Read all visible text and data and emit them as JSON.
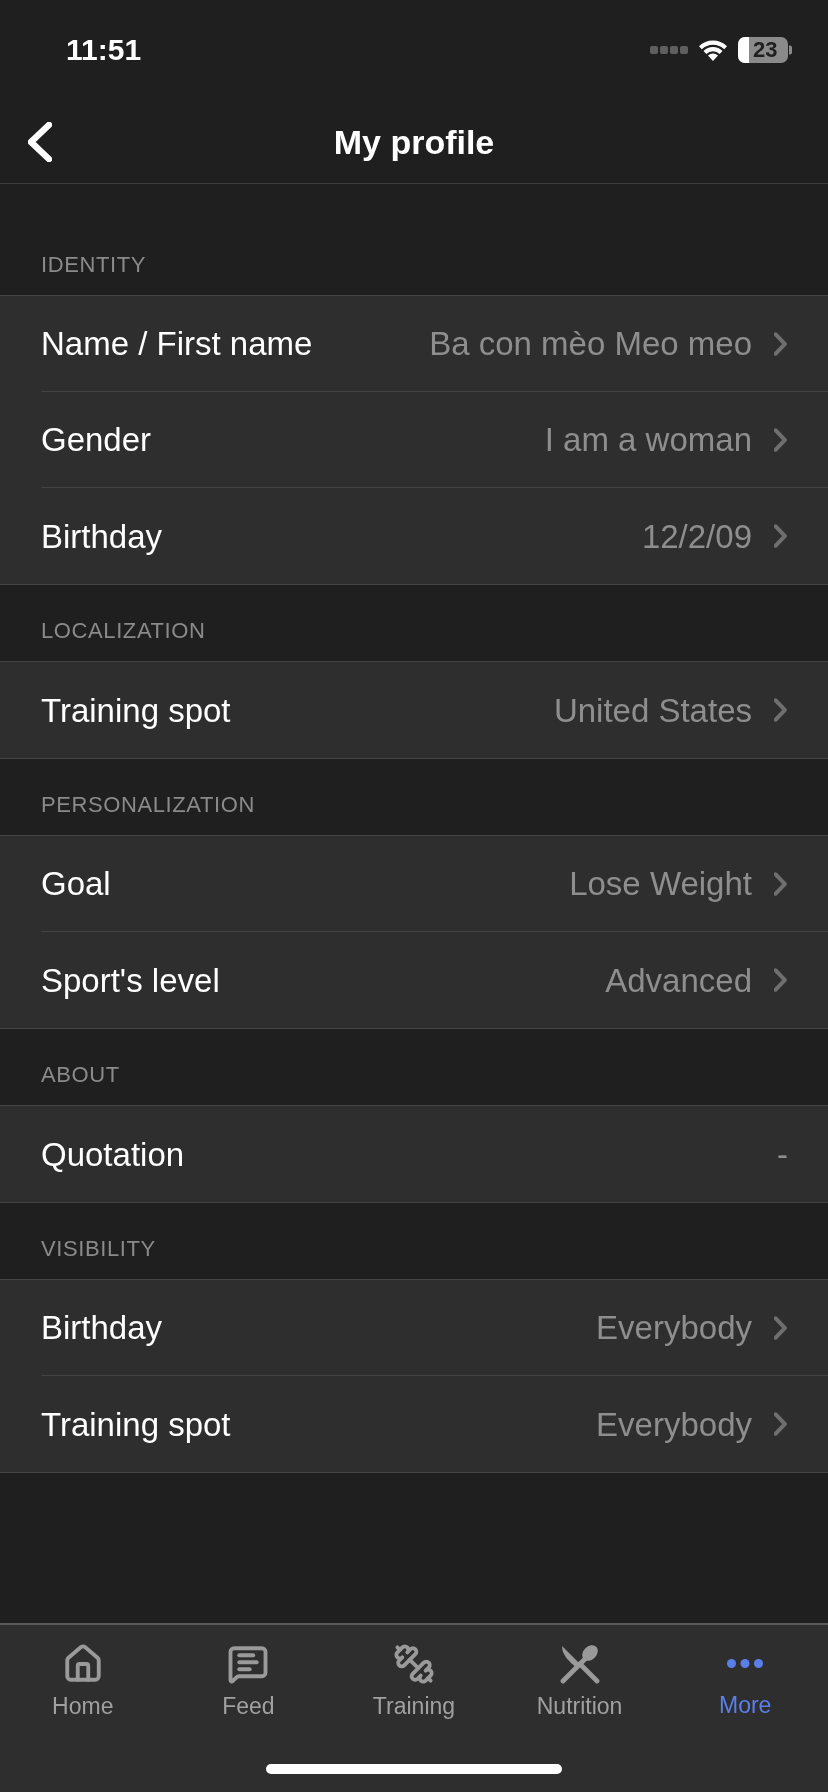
{
  "status_bar": {
    "time": "11:51",
    "battery": "23"
  },
  "nav": {
    "title": "My profile"
  },
  "sections": [
    {
      "header": "IDENTITY",
      "rows": [
        {
          "label": "Name / First name",
          "value": "Ba con mèo Meo meo",
          "chevron": true
        },
        {
          "label": "Gender",
          "value": "I am a woman",
          "chevron": true
        },
        {
          "label": "Birthday",
          "value": "12/2/09",
          "chevron": true
        }
      ]
    },
    {
      "header": "LOCALIZATION",
      "rows": [
        {
          "label": "Training spot",
          "value": "United States",
          "chevron": true
        }
      ]
    },
    {
      "header": "PERSONALIZATION",
      "rows": [
        {
          "label": "Goal",
          "value": "Lose Weight",
          "chevron": true
        },
        {
          "label": "Sport's level",
          "value": "Advanced",
          "chevron": true
        }
      ]
    },
    {
      "header": "ABOUT",
      "rows": [
        {
          "label": "Quotation",
          "value": "-",
          "chevron": false
        }
      ]
    },
    {
      "header": "VISIBILITY",
      "rows": [
        {
          "label": "Birthday",
          "value": "Everybody",
          "chevron": true
        },
        {
          "label": "Training spot",
          "value": "Everybody",
          "chevron": true
        }
      ]
    }
  ],
  "tab_bar": [
    {
      "kind": "home",
      "label": "Home",
      "selected": false
    },
    {
      "kind": "feed",
      "label": "Feed",
      "selected": false
    },
    {
      "kind": "training",
      "label": "Training",
      "selected": false
    },
    {
      "kind": "nutrition",
      "label": "Nutrition",
      "selected": false
    },
    {
      "kind": "more",
      "label": "More",
      "selected": true
    }
  ]
}
